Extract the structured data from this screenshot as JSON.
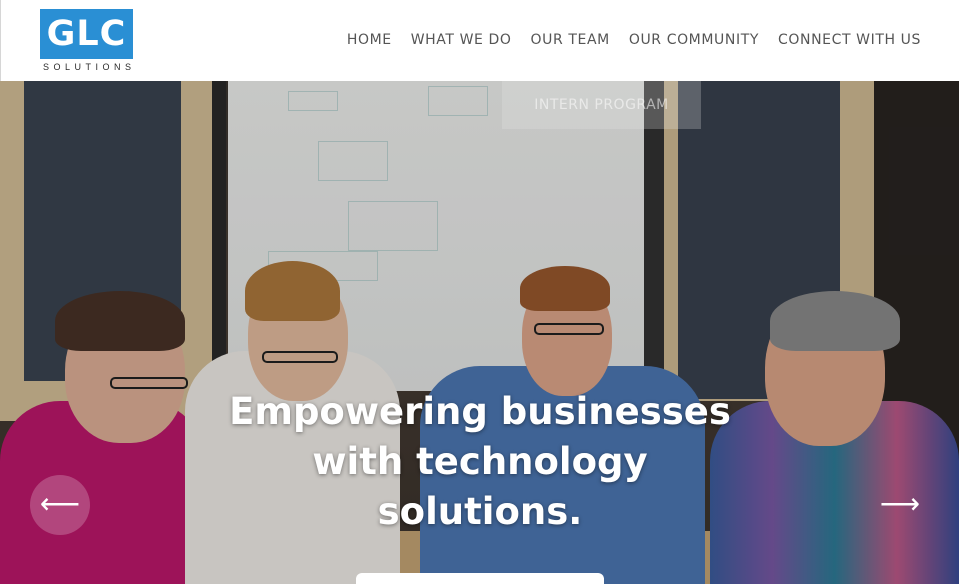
{
  "brand": {
    "logo_text": "GLC",
    "logo_subtext": "SOLUTIONS",
    "accent_color": "#2a8fd4"
  },
  "nav": {
    "items": [
      {
        "label": "HOME"
      },
      {
        "label": "WHAT WE DO"
      },
      {
        "label": "OUR TEAM"
      },
      {
        "label": "OUR COMMUNITY"
      },
      {
        "label": "CONNECT WITH US"
      }
    ]
  },
  "dropdown": {
    "partial_item": "INTERN PROGRAM"
  },
  "hero": {
    "headline_line1": "Empowering businesses",
    "headline_line2": "with technology",
    "headline_line3": "solutions.",
    "prev_icon": "arrow-left-icon",
    "next_icon": "arrow-right-icon",
    "prev_glyph": "⟵",
    "next_glyph": "⟶"
  }
}
